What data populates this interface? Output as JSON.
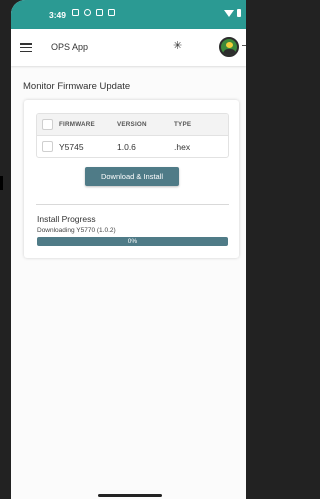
{
  "status_bar": {
    "time": "3:49",
    "icons": [
      "sim-icon",
      "settings-icon",
      "image-icon",
      "image-icon"
    ]
  },
  "app_bar": {
    "title": "OPS App"
  },
  "page": {
    "heading": "Monitor Firmware Update"
  },
  "firmware_table": {
    "columns": [
      "FIRMWARE",
      "VERSION",
      "TYPE"
    ],
    "rows": [
      {
        "firmware": "Y5745",
        "version": "1.0.6",
        "type": ".hex",
        "checked": false
      }
    ]
  },
  "download_button": {
    "label": "Download & Install"
  },
  "install": {
    "label": "Install Progress",
    "status": "Downloading Y5770 (1.0.2)",
    "progress_text": "0%",
    "progress_percent": 0
  },
  "colors": {
    "status_bar": "#2b9a93",
    "button": "#4f7b87"
  }
}
